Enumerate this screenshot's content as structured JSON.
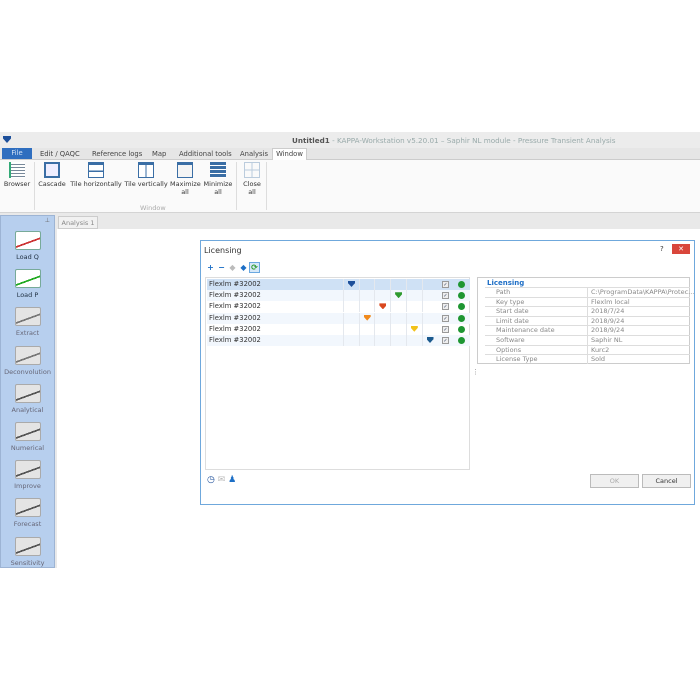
{
  "app": {
    "doc": "Untitled1",
    "title_rest": " - KAPPA-Workstation v5.20.01 – Saphir NL module - Pressure Transient Analysis"
  },
  "menu": {
    "file": "File",
    "tabs": [
      "Edit / QAQC",
      "Reference logs",
      "Map",
      "Additional tools",
      "Analysis",
      "Window"
    ]
  },
  "ribbon": {
    "browser": "Browser",
    "buttons": [
      {
        "l1": "Cascade",
        "l2": ""
      },
      {
        "l1": "Tile horizontally",
        "l2": ""
      },
      {
        "l1": "Tile vertically",
        "l2": ""
      },
      {
        "l1": "Maximize",
        "l2": "all"
      },
      {
        "l1": "Minimize",
        "l2": "all"
      },
      {
        "l1": "Close",
        "l2": "all"
      }
    ],
    "group": "Window"
  },
  "tools": [
    "Load Q",
    "Load P",
    "Extract",
    "Deconvolution",
    "Analytical",
    "Numerical",
    "Improve",
    "Forecast",
    "Sensitivity"
  ],
  "doc_tab": "Analysis 1",
  "dialog": {
    "title": "Licensing",
    "help": "?",
    "close": "✕",
    "ok": "OK",
    "cancel": "Cancel",
    "rows": [
      {
        "name": "Flexlm #32002",
        "col": 0,
        "color": "#1d4f9a"
      },
      {
        "name": "Flexlm #32002",
        "col": 3,
        "color": "#2e9a2e"
      },
      {
        "name": "Flexlm #32002",
        "col": 2,
        "color": "#d9471e"
      },
      {
        "name": "Flexlm #32002",
        "col": 1,
        "color": "#f08a1c"
      },
      {
        "name": "Flexlm #32002",
        "col": 4,
        "color": "#f2c21a"
      },
      {
        "name": "Flexlm #32002",
        "col": 5,
        "color": "#1b5a8e"
      }
    ],
    "props_title": "Licensing",
    "props": [
      {
        "k": "Path",
        "v": "C:\\ProgramData\\KAPPA\\Protec..."
      },
      {
        "k": "Key type",
        "v": "Flexlm local"
      },
      {
        "k": "Start date",
        "v": "2018/7/24"
      },
      {
        "k": "Limit date",
        "v": "2018/9/24"
      },
      {
        "k": "Maintenance date",
        "v": "2018/9/24"
      },
      {
        "k": "Software",
        "v": "Saphir NL"
      },
      {
        "k": "Options",
        "v": "Kurc2"
      },
      {
        "k": "License Type",
        "v": "Sold"
      }
    ]
  }
}
